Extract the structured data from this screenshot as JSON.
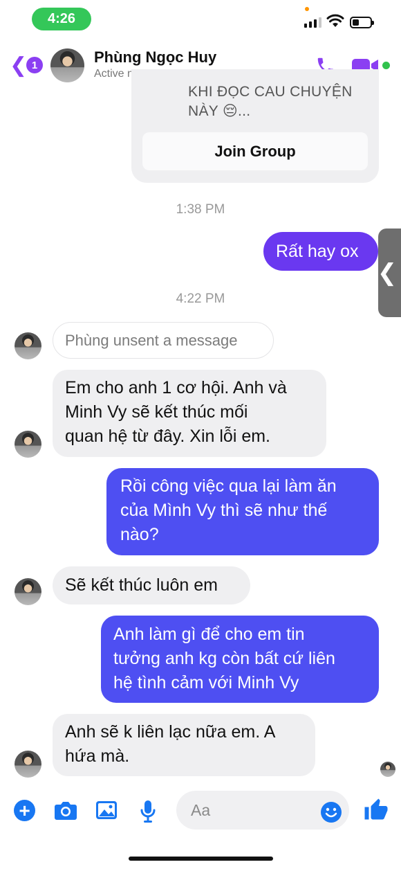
{
  "status_bar": {
    "time": "4:26"
  },
  "header": {
    "back_count": "1",
    "contact_name": "Phùng Ngọc Huy",
    "contact_status": "Active now"
  },
  "shared_card": {
    "text_line1": "KHI ĐỌC CAU CHUYỆN",
    "text_line2": "NÀY 😔...",
    "join_label": "Join Group"
  },
  "messages": {
    "ts1": "1:38 PM",
    "sent1": "Rất hay ox",
    "ts2": "4:22 PM",
    "unsent": "Phùng unsent a message",
    "recv1_l1": "Em cho anh 1 cơ hội. Anh và",
    "recv1_l2": "Minh Vy sẽ kết thúc mối",
    "recv1_l3": "quan hệ từ đây. Xin lỗi em.",
    "sent2_l1": "Rồi công việc qua lại làm ăn",
    "sent2_l2": "của Mình Vy thì sẽ như thế",
    "sent2_l3": "nào?",
    "recv2": "Sẽ kết thúc luôn em",
    "sent3_l1": "Anh làm gì để cho em tin",
    "sent3_l2": "tưởng anh kg còn bất cứ liên",
    "sent3_l3": "hệ tình cảm với Minh Vy",
    "recv3_l1": "Anh sẽ k liên lạc nữa em. A",
    "recv3_l2": "hứa mà."
  },
  "composer": {
    "placeholder": "Aa"
  },
  "colors": {
    "accent": "#8b3ff2",
    "sent_bubble_top": "#6a38f0",
    "sent_bubble_bottom": "#4e4ff2",
    "received_bubble": "#efeff1",
    "composer_blue": "#1877f2",
    "online_green": "#31c24d"
  },
  "icons": [
    "chevron-left-icon",
    "phone-icon",
    "video-camera-icon",
    "plus-icon",
    "camera-icon",
    "gallery-icon",
    "microphone-icon",
    "emoji-icon",
    "thumbs-up-icon"
  ]
}
